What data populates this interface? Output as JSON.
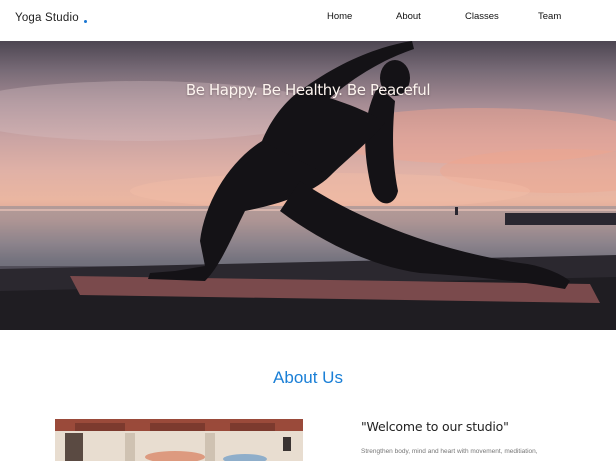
{
  "brand": {
    "name": "Yoga Studio"
  },
  "nav": {
    "items": [
      {
        "label": "Home"
      },
      {
        "label": "About"
      },
      {
        "label": "Classes"
      },
      {
        "label": "Team"
      }
    ]
  },
  "hero": {
    "title": "Be Happy. Be Healthy. Be Peaceful",
    "image": "yoga-pose-sunset-photo"
  },
  "about": {
    "title": "About Us",
    "welcome": "\"Welcome to our studio\"",
    "description": "Strengthen body, mind and heart with movement, meditiation,"
  },
  "colors": {
    "accent": "#1a7fd6",
    "header_bg": "#ffffff"
  }
}
